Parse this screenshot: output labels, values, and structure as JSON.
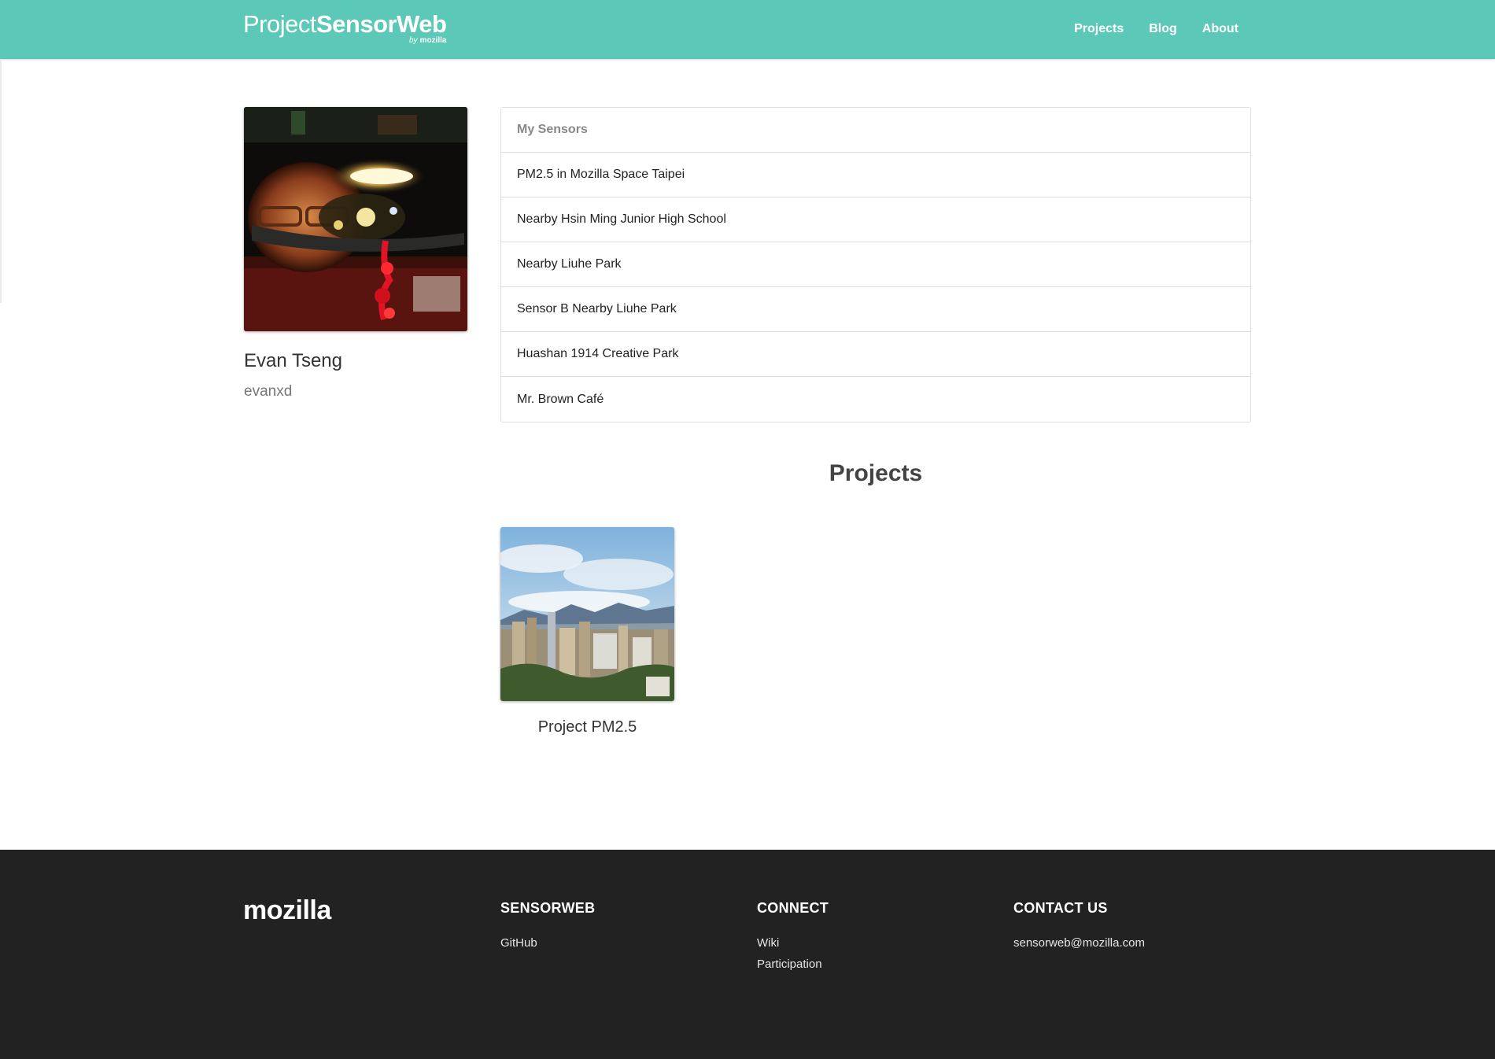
{
  "navbar": {
    "brand_prefix": "Project",
    "brand_name": "SensorWeb",
    "brand_by": "by",
    "brand_org": "mozilla",
    "links": [
      "Projects",
      "Blog",
      "About"
    ],
    "color": "#5cc8b7"
  },
  "profile": {
    "name": "Evan Tseng",
    "username": "evanxd"
  },
  "sensors": {
    "header": "My Sensors",
    "items": [
      "PM2.5 in Mozilla Space Taipei",
      "Nearby Hsin Ming Junior High School",
      "Nearby Liuhe Park",
      "Sensor B Nearby Liuhe Park",
      "Huashan 1914 Creative Park",
      "Mr. Brown Café"
    ]
  },
  "projects": {
    "title": "Projects",
    "items": [
      {
        "name": "Project PM2.5"
      }
    ]
  },
  "footer": {
    "logo": "mozilla",
    "columns": [
      {
        "title": "SENSORWEB",
        "links": [
          "GitHub"
        ]
      },
      {
        "title": "CONNECT",
        "links": [
          "Wiki",
          "Participation"
        ]
      },
      {
        "title": "CONTACT US",
        "links": [
          "sensorweb@mozilla.com"
        ]
      }
    ],
    "background": "#222222"
  }
}
